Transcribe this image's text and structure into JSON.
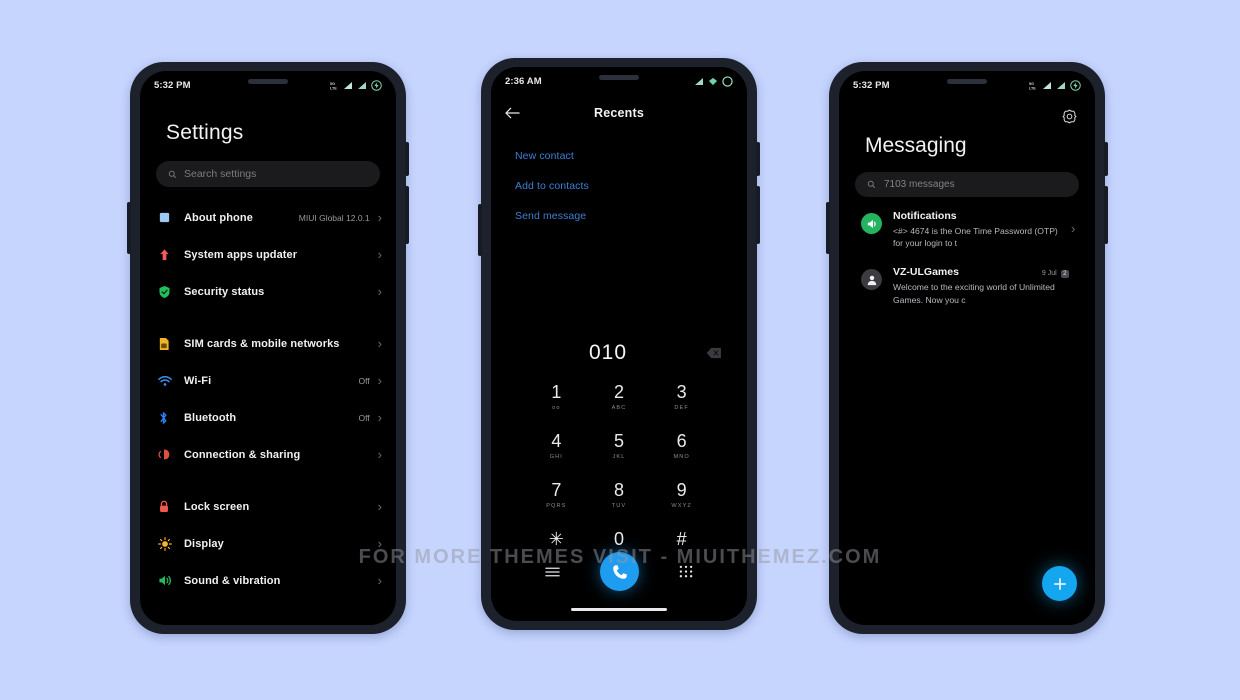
{
  "background_color": "#c6d5fe",
  "watermark": "FOR MORE THEMES VISIT - MIUITHEMEZ.COM",
  "accent_colors": {
    "dial_blue": "#1e9df0",
    "fab_blue": "#15a6f0",
    "link_blue": "#3e7fd4",
    "unread_dot": "#2c7ef0"
  },
  "phone_settings": {
    "status_bar": {
      "time": "5:32 PM",
      "icons": [
        "sim-lte-icon",
        "signal-bars-icon",
        "signal-bars-icon",
        "battery-charging-icon"
      ]
    },
    "title": "Settings",
    "search": {
      "placeholder": "Search settings",
      "icon": "search-icon"
    },
    "groups": [
      {
        "items": [
          {
            "label": "About phone",
            "value": "MIUI Global 12.0.1",
            "icon": "about-phone-icon",
            "icon_color": "#9ec9f5"
          },
          {
            "label": "System apps updater",
            "value": "",
            "icon": "up-arrow-icon",
            "icon_color": "#f05a5a"
          },
          {
            "label": "Security status",
            "value": "",
            "icon": "shield-check-icon",
            "icon_color": "#20c05a"
          }
        ]
      },
      {
        "items": [
          {
            "label": "SIM cards & mobile networks",
            "value": "",
            "icon": "sim-card-icon",
            "icon_color": "#f0b429"
          },
          {
            "label": "Wi-Fi",
            "value": "Off",
            "icon": "wifi-icon",
            "icon_color": "#3b8ef0"
          },
          {
            "label": "Bluetooth",
            "value": "Off",
            "icon": "bluetooth-icon",
            "icon_color": "#2f7ff0"
          },
          {
            "label": "Connection & sharing",
            "value": "",
            "icon": "connection-sharing-icon",
            "icon_color": "#e0503f"
          }
        ]
      },
      {
        "items": [
          {
            "label": "Lock screen",
            "value": "",
            "icon": "lock-icon",
            "icon_color": "#f0584c"
          },
          {
            "label": "Display",
            "value": "",
            "icon": "brightness-icon",
            "icon_color": "#f5b820"
          },
          {
            "label": "Sound & vibration",
            "value": "",
            "icon": "speaker-icon",
            "icon_color": "#26b85e"
          }
        ]
      }
    ]
  },
  "phone_dialer": {
    "status_bar": {
      "time": "2:36 AM",
      "icons": [
        "signal-bars-icon",
        "wifi-icon",
        "circle-icon"
      ]
    },
    "back_icon": "back-arrow-icon",
    "title": "Recents",
    "actions": [
      "New contact",
      "Add to contacts",
      "Send message"
    ],
    "dialed_number": "010",
    "delete_icon": "backspace-icon",
    "keys": [
      {
        "digit": "1",
        "letters": "oo"
      },
      {
        "digit": "2",
        "letters": "ABC"
      },
      {
        "digit": "3",
        "letters": "DEF"
      },
      {
        "digit": "4",
        "letters": "GHI"
      },
      {
        "digit": "5",
        "letters": "JKL"
      },
      {
        "digit": "6",
        "letters": "MNO"
      },
      {
        "digit": "7",
        "letters": "PQRS"
      },
      {
        "digit": "8",
        "letters": "TUV"
      },
      {
        "digit": "9",
        "letters": "WXYZ"
      },
      {
        "digit": "✳",
        "letters": ""
      },
      {
        "digit": "0",
        "letters": ""
      },
      {
        "digit": "#",
        "letters": ""
      }
    ],
    "bottom_bar": {
      "menu_icon": "menu-icon",
      "call_icon": "call-icon",
      "keypad_icon": "keypad-icon"
    }
  },
  "phone_messaging": {
    "status_bar": {
      "time": "5:32 PM",
      "icons": [
        "sim-lte-icon",
        "signal-bars-icon",
        "signal-bars-icon",
        "battery-charging-icon"
      ]
    },
    "settings_icon": "gear-icon",
    "title": "Messaging",
    "search": {
      "placeholder": "7103 messages",
      "icon": "search-icon"
    },
    "threads": [
      {
        "name": "Notifications",
        "preview": "<#> 4674 is the One Time Password (OTP) for your login to t",
        "time": "",
        "badge": "",
        "unread": true,
        "avatar": "megaphone-icon"
      },
      {
        "name": "VZ-ULGames",
        "preview": "Welcome to the exciting world of Unlimited Games. Now you c",
        "time": "9 Jul",
        "badge": "2",
        "unread": false,
        "avatar": "person-icon"
      }
    ],
    "fab_icon": "plus-icon"
  }
}
